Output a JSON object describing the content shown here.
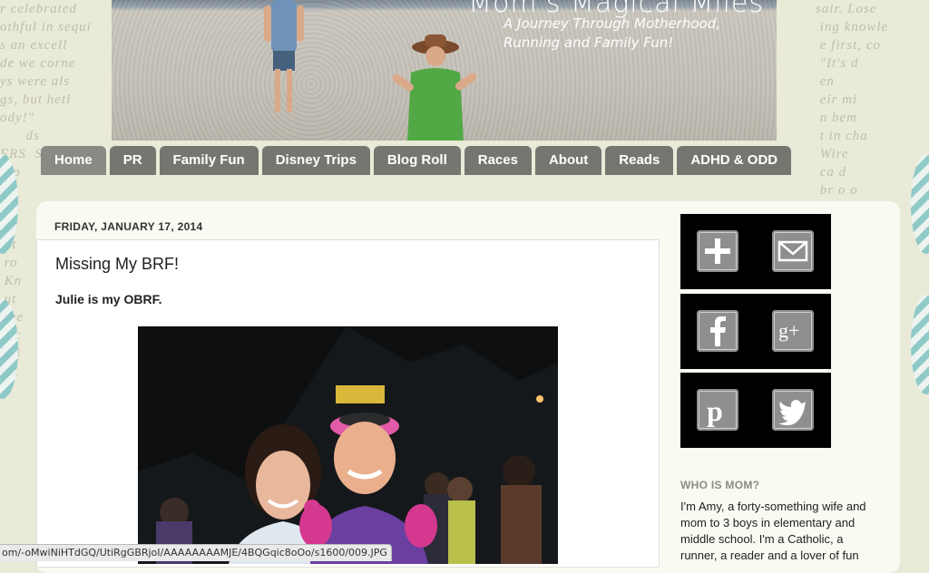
{
  "header": {
    "blog_title": "Mom's Magical Miles",
    "description": "A Journey Through Motherhood, Running and Family Fun!"
  },
  "nav": {
    "tabs": [
      {
        "label": "Home"
      },
      {
        "label": "PR"
      },
      {
        "label": "Family Fun"
      },
      {
        "label": "Disney Trips"
      },
      {
        "label": "Blog Roll"
      },
      {
        "label": "Races"
      },
      {
        "label": "About"
      },
      {
        "label": "Reads"
      },
      {
        "label": "ADHD & ODD"
      }
    ],
    "active": "Home"
  },
  "post": {
    "date": "FRIDAY, JANUARY 17, 2014",
    "title": "Missing My BRF!",
    "subtitle": "Julie is my OBRF."
  },
  "sidebar": {
    "social": [
      {
        "icon": "plus-icon"
      },
      {
        "icon": "email-icon"
      },
      {
        "icon": "facebook-icon"
      },
      {
        "icon": "google-plus-icon"
      },
      {
        "icon": "pinterest-icon"
      },
      {
        "icon": "twitter-icon"
      }
    ],
    "about_title": "WHO IS MOM?",
    "about_text": "I'm Amy, a forty-something wife and mom to 3 boys in elementary and middle school. I'm a Catholic, a runner, a reader and a lover of fun"
  },
  "status_bar": {
    "url": "om/-oMwiNiHTdGQ/UtiRgGBRjoI/AAAAAAAAMJE/4BQGqic8oOo/s1600/009.JPG"
  },
  "colors": {
    "tab_bg": "#767671",
    "page_bg": "#e9ead8",
    "card_bg": "#faf9f3",
    "social_bg": "#000000",
    "icon_gray": "#8f8f8f"
  }
}
